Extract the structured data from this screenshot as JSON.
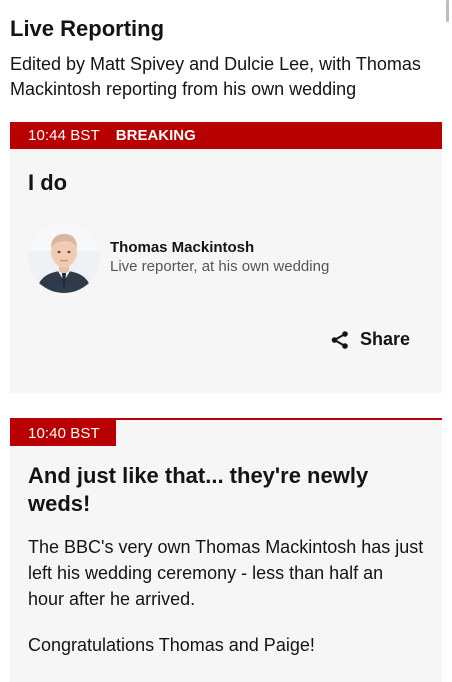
{
  "header": {
    "title": "Live Reporting",
    "editors": "Edited by Matt Spivey and Dulcie Lee, with Thomas Mackintosh reporting from his own wedding"
  },
  "posts": [
    {
      "time": "10:44 BST",
      "badge": "BREAKING",
      "headline": "I do",
      "author_name": "Thomas Mackintosh",
      "author_role": "Live reporter, at his own wedding",
      "share_label": "Share"
    },
    {
      "time": "10:40 BST",
      "headline": "And just like that... they're newly weds!",
      "paragraphs": [
        "The BBC's very own Thomas Mackintosh has just left his wedding ceremony - less than half an hour after he arrived.",
        "Congratulations Thomas and Paige!"
      ]
    }
  ],
  "colors": {
    "accent": "#b80000",
    "card_bg": "#f6f6f6",
    "muted_text": "#545658"
  },
  "icons": {
    "share": "share-icon",
    "avatar": "avatar"
  }
}
